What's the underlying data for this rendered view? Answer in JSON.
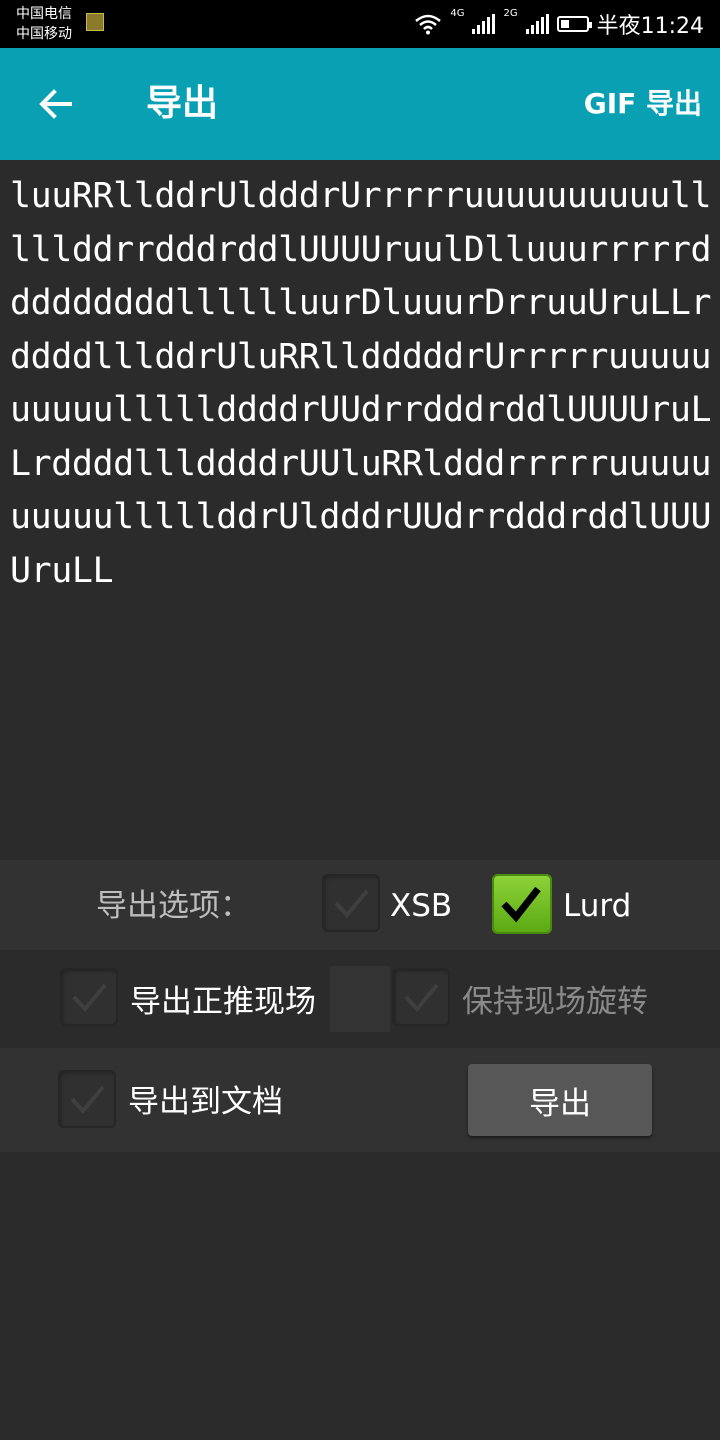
{
  "statusbar": {
    "carrier1": "中国电信",
    "carrier2": "中国移动",
    "net1": "4G",
    "net2": "2G",
    "time": "半夜11:24"
  },
  "appbar": {
    "back_icon": "arrow-left-icon",
    "title": "导出",
    "gif_export": "GIF 导出",
    "color": "#0aa0b4"
  },
  "solution_text": "luuRRllddrUldddrUrrrrruuuuuuuuuulllllddrrdddrddlUUUUruulDlluuurrrrrdddddddddlllllluurDluuurDrruuUruLLrddddlllddrUluRRlldddddrUrrrrruuuuuuuuuulllllddddrUUdrrdddrddlUUUUruLLrddddlllddddrUUluRRldddrrrrruuuuuuuuuulllllddrUldddrUUdrrdddrddlUUUUruLL",
  "options": {
    "label": "导出选项：",
    "xsb": {
      "label": "XSB",
      "checked": false
    },
    "lurd": {
      "label": "Lurd",
      "checked": true
    },
    "push_scene": {
      "label": "导出正推现场",
      "checked": false
    },
    "keep_rotation": {
      "label": "保持现场旋转",
      "checked": false,
      "enabled": false
    },
    "to_document": {
      "label": "导出到文档",
      "checked": false
    }
  },
  "export_button": "导出",
  "colors": {
    "background": "#2b2b2b",
    "checked_green": "#6cc020"
  }
}
